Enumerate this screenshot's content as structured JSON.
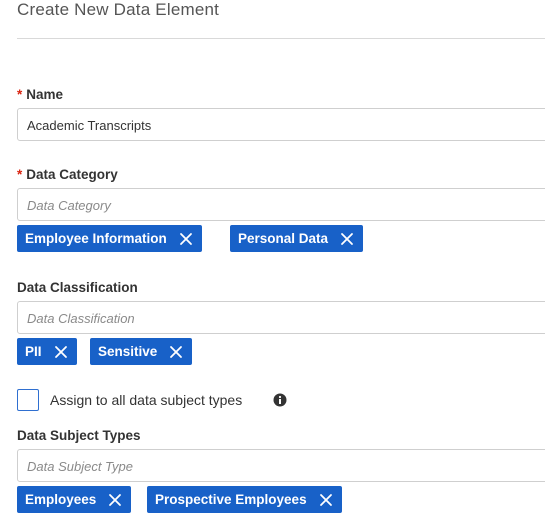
{
  "page": {
    "title": "Create New Data Element"
  },
  "name_field": {
    "required_marker": "*",
    "label": "Name",
    "value": "Academic Transcripts"
  },
  "data_category": {
    "required_marker": "*",
    "label": "Data Category",
    "placeholder": "Data Category",
    "chips": [
      {
        "label": "Employee Information"
      },
      {
        "label": "Personal Data"
      }
    ]
  },
  "data_classification": {
    "label": "Data Classification",
    "placeholder": "Data Classification",
    "chips": [
      {
        "label": "PII"
      },
      {
        "label": "Sensitive"
      }
    ]
  },
  "assign_all": {
    "label": "Assign to all data subject types",
    "checked": false,
    "info_icon": "info-icon"
  },
  "data_subject_types": {
    "label": "Data Subject Types",
    "placeholder": "Data Subject Type",
    "chips": [
      {
        "label": "Employees"
      },
      {
        "label": "Prospective Employees"
      }
    ]
  },
  "colors": {
    "chip_background": "#1861c8",
    "required_marker": "#d9230f",
    "checkbox_border": "#2f6fd0"
  }
}
